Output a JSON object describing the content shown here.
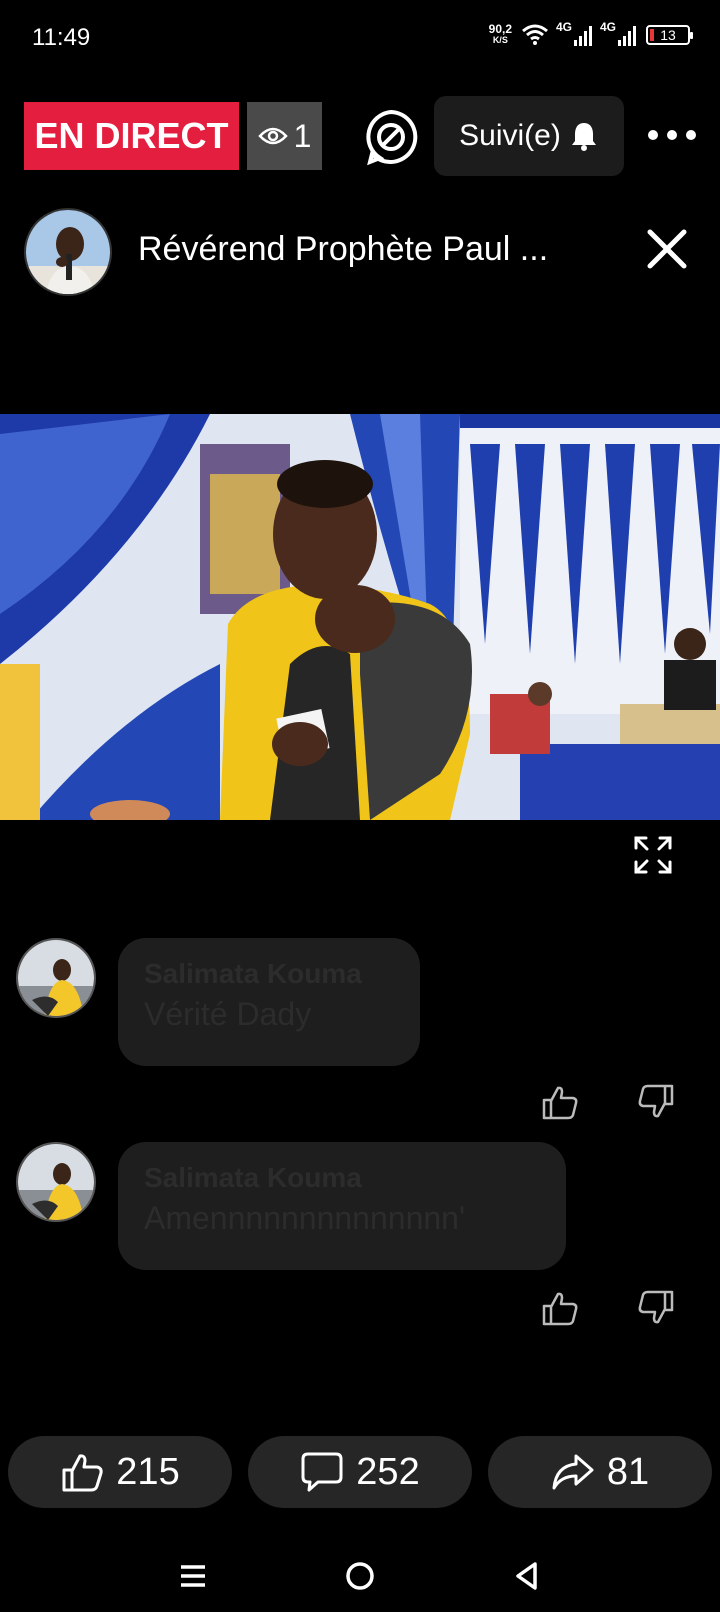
{
  "status_bar": {
    "time": "11:49",
    "net_speed_value": "90,2",
    "net_speed_unit": "K/S",
    "signal1_label": "4G",
    "signal2_label": "4G",
    "battery_level": "13"
  },
  "top_bar": {
    "live_label": "EN DIRECT",
    "viewer_count": "1",
    "follow_label": "Suivi(e)"
  },
  "host": {
    "name": "Révérend Prophète Paul ..."
  },
  "comments": [
    {
      "author": "Salimata Kouma",
      "text": "Vérité Dady"
    },
    {
      "author": "Salimata Kouma",
      "text": "Amennnnnnnnnnnnnn'"
    }
  ],
  "actions": {
    "likes": "215",
    "comments": "252",
    "shares": "81"
  },
  "colors": {
    "live_red": "#e41e3f",
    "background": "#000000"
  }
}
